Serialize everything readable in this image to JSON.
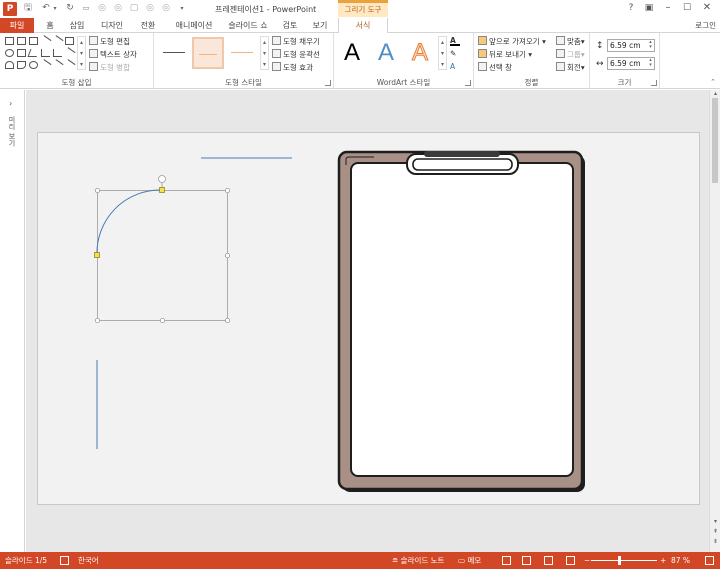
{
  "app": {
    "title": "프레젠테이션1 - PowerPoint",
    "context_header": "그리기 도구",
    "login_label": "로그인",
    "icons": {
      "app": "powerpoint-icon",
      "qat": [
        "save-icon",
        "undo-icon",
        "undo-dropdown-icon",
        "redo-icon",
        "start-from-beginning-icon",
        "shape-icon",
        "shape-icon",
        "shape-icon",
        "shape-icon",
        "shape-icon",
        "customize-qat-icon"
      ],
      "window": [
        "help-icon",
        "ribbon-display-options-icon",
        "minimize-icon",
        "maximize-icon",
        "close-icon"
      ]
    }
  },
  "tabs": [
    "파일",
    "홈",
    "삽입",
    "디자인",
    "전환",
    "애니메이션",
    "슬라이드 쇼",
    "검토",
    "보기",
    "서식"
  ],
  "active_tab": "서식",
  "ribbon": {
    "insert_shapes": {
      "label": "도형 삽입",
      "edit_shape": "도형 편집",
      "text_box": "텍스트 상자",
      "merge_shapes": "도형 병합"
    },
    "shape_styles": {
      "label": "도형 스타일",
      "fill": "도형 채우기",
      "outline": "도형 윤곽선",
      "effects": "도형 효과",
      "line_colors": [
        "#555555",
        "#f4b183",
        "#f4b183"
      ]
    },
    "wordart": {
      "label": "WordArt 스타일",
      "letters": [
        "A",
        "A",
        "A"
      ],
      "colors": [
        "#000000",
        "#4f8fc7",
        "#ed7d31"
      ]
    },
    "arrange": {
      "label": "정렬",
      "bring_forward": "앞으로 가져오기",
      "send_backward": "뒤로 보내기",
      "selection_pane": "선택 창",
      "align": "맞춤",
      "group": "그룹",
      "rotate": "회전"
    },
    "size": {
      "label": "크기",
      "height": "6.59 cm",
      "width": "6.59 cm"
    }
  },
  "thumbnail_pane": {
    "expand_icon": "chevron-right-icon",
    "label": "미리 보기"
  },
  "status": {
    "slide": "슬라이드 1/5",
    "language": "한국어",
    "notes": "슬라이드 노트",
    "comments": "메모",
    "zoom": "87 %",
    "zoom_percent": 87,
    "accent": "#d24726"
  },
  "canvas": {
    "clipboard_board_color": "#a89086",
    "clip_color": "#3a3a3a",
    "selected_arc_color": "#4a7ab5"
  }
}
